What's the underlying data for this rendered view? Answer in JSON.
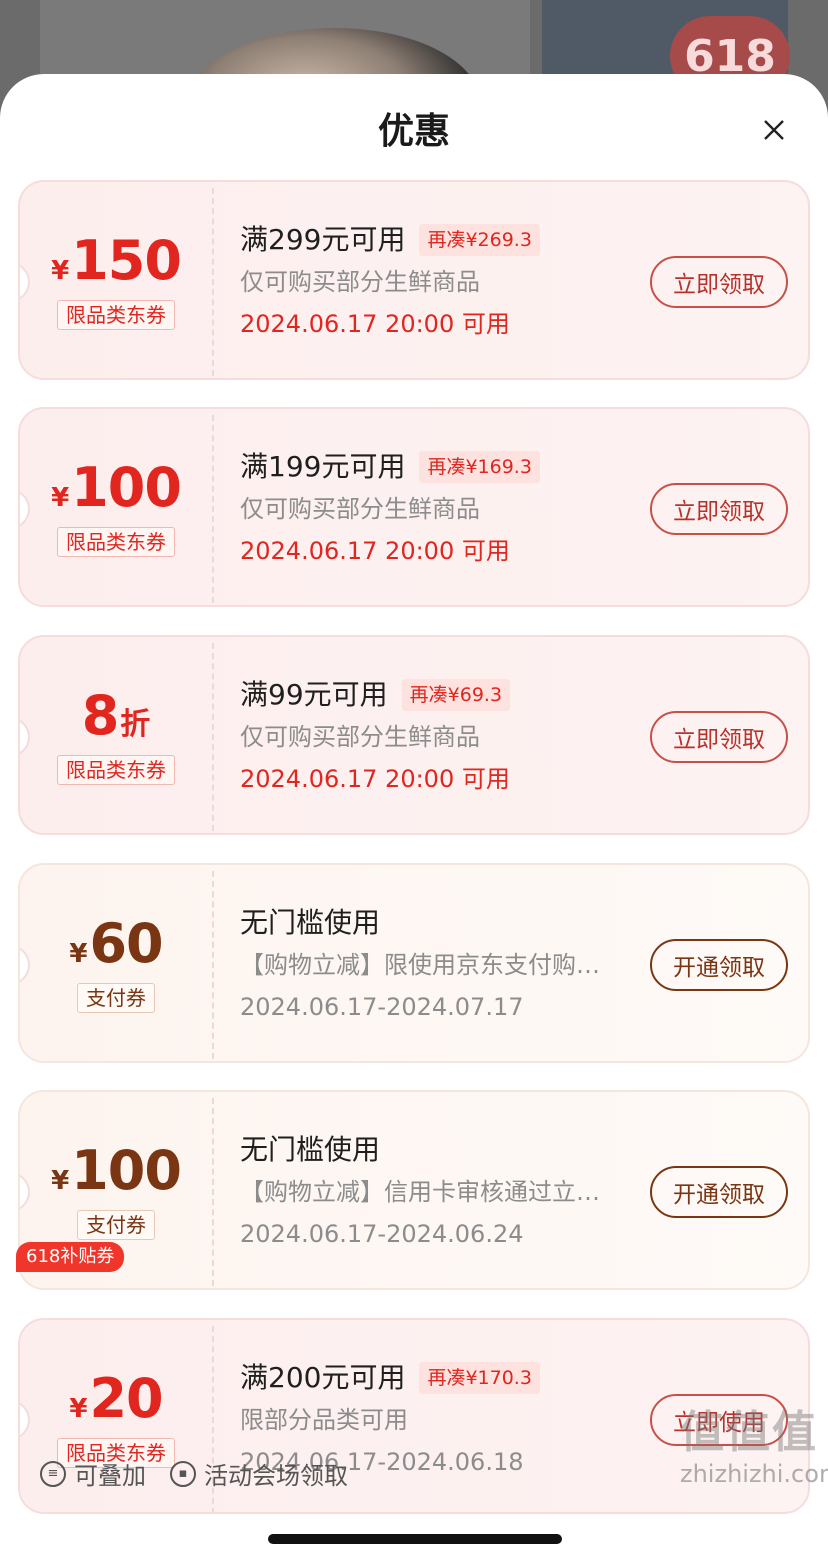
{
  "background": {
    "badge_text": "618"
  },
  "sheet": {
    "title": "优惠",
    "close_icon": "close-icon"
  },
  "coupons": [
    {
      "style": "red",
      "currency": "¥",
      "amount": "150",
      "unit": "",
      "tag": "限品类东券",
      "condition": "满299元可用",
      "diff": "再凑¥269.3",
      "desc": "仅可购买部分生鲜商品",
      "date": "2024.06.17 20:00 可用",
      "action": "立即领取"
    },
    {
      "style": "red",
      "currency": "¥",
      "amount": "100",
      "unit": "",
      "tag": "限品类东券",
      "condition": "满199元可用",
      "diff": "再凑¥169.3",
      "desc": "仅可购买部分生鲜商品",
      "date": "2024.06.17 20:00 可用",
      "action": "立即领取"
    },
    {
      "style": "red",
      "currency": "",
      "amount": "8",
      "unit": "折",
      "tag": "限品类东券",
      "condition": "满99元可用",
      "diff": "再凑¥69.3",
      "desc": "仅可购买部分生鲜商品",
      "date": "2024.06.17 20:00 可用",
      "action": "立即领取"
    },
    {
      "style": "pay",
      "currency": "¥",
      "amount": "60",
      "unit": "",
      "tag": "支付券",
      "condition": "无门槛使用",
      "diff": "",
      "desc": "【购物立减】限使用京东支付购…",
      "date": "2024.06.17-2024.07.17",
      "action": "开通领取"
    },
    {
      "style": "pay",
      "currency": "¥",
      "amount": "100",
      "unit": "",
      "tag": "支付券",
      "condition": "无门槛使用",
      "diff": "",
      "desc": "【购物立减】信用卡审核通过立…",
      "date": "2024.06.17-2024.06.24",
      "action": "开通领取"
    },
    {
      "style": "red",
      "currency": "¥",
      "amount": "20",
      "unit": "",
      "tag": "限品类东券",
      "ribbon": "618补贴券",
      "condition": "满200元可用",
      "diff": "再凑¥170.3",
      "desc": "限部分品类可用",
      "date": "2024.06.17-2024.06.18",
      "action": "立即使用"
    }
  ],
  "legend": {
    "stackable": "可叠加",
    "venue": "活动会场领取"
  },
  "watermark": {
    "big": "值值值",
    "site": "zhizhizhi.com"
  },
  "colors": {
    "accent_red": "#e0261e",
    "pay_brown": "#7a3512"
  }
}
